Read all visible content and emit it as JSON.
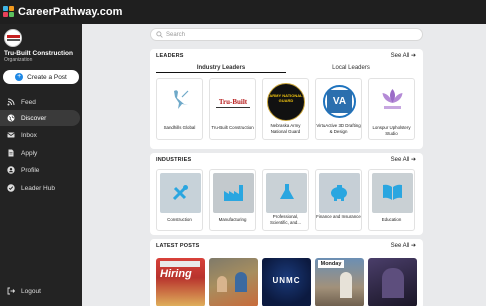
{
  "app": {
    "brand": "CareerPathway.com"
  },
  "sidebar": {
    "org_name": "Tru-Built Construction",
    "org_type": "Organization",
    "create_label": "Create a Post",
    "items": [
      {
        "label": "Feed",
        "icon": "feed-icon",
        "active": false
      },
      {
        "label": "Discover",
        "icon": "globe-icon",
        "active": true
      },
      {
        "label": "Inbox",
        "icon": "mail-icon",
        "active": false
      },
      {
        "label": "Apply",
        "icon": "document-icon",
        "active": false
      },
      {
        "label": "Profile",
        "icon": "user-icon",
        "active": false
      },
      {
        "label": "Leader Hub",
        "icon": "check-badge-icon",
        "active": false
      }
    ],
    "logout_label": "Logout"
  },
  "search": {
    "placeholder": "Search"
  },
  "leaders": {
    "title": "LEADERS",
    "see_all": "See All",
    "tabs": [
      "Industry Leaders",
      "Local Leaders"
    ],
    "cards": [
      {
        "name": "Sandhills Global"
      },
      {
        "name": "Tru-Built Construction",
        "logo_text": "Tru-Built"
      },
      {
        "name": "Nebraska Army National Guard",
        "logo_text": "ARMY NATIONAL GUARD"
      },
      {
        "name": "VirtuActive 3D Drafting & Design",
        "logo_text": "VA"
      },
      {
        "name": "Lonspur Upholstery Studio"
      }
    ]
  },
  "industries": {
    "title": "INDUSTRIES",
    "see_all": "See All",
    "cards": [
      {
        "name": "Construction"
      },
      {
        "name": "Manufacturing"
      },
      {
        "name": "Professional, Scientific, and..."
      },
      {
        "name": "Finance and Insurance"
      },
      {
        "name": "Education"
      }
    ]
  },
  "latest_posts": {
    "title": "LATEST POSTS",
    "see_all": "See All",
    "posts": [
      {
        "text": "Hiring"
      },
      {
        "text": ""
      },
      {
        "text": "UNMC"
      },
      {
        "text": "Monday"
      },
      {
        "text": ""
      }
    ]
  },
  "colors": {
    "topbar": "#1f1f1f",
    "sidebar": "#232323",
    "accent": "#1e88e5",
    "background": "#e9eaec"
  }
}
